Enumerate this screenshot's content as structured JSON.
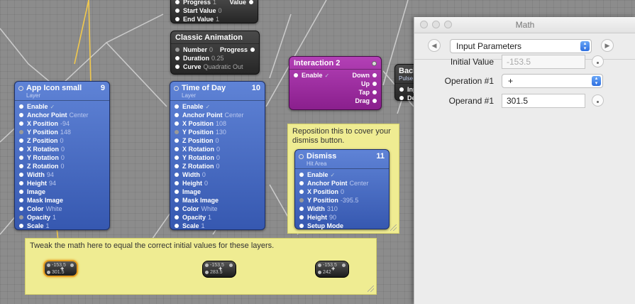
{
  "colors": {
    "note_bg": "#efec92",
    "blue_patch": "#3658b0",
    "purple_patch": "#8a1f8d",
    "dark_patch": "#262626",
    "selection": "#e8a020"
  },
  "top_patch": {
    "rows": [
      {
        "label": "Progress",
        "value": "1"
      },
      {
        "label": "Start Value",
        "value": "0"
      },
      {
        "label": "End Value",
        "value": "1"
      }
    ],
    "right_label": "Value"
  },
  "classic": {
    "title": "Classic Animation",
    "rows": [
      {
        "label": "Number",
        "value": "0"
      },
      {
        "label": "Duration",
        "value": "0.25"
      },
      {
        "label": "Curve",
        "value": "Quadratic Out"
      }
    ],
    "output_label": "Progress"
  },
  "interaction": {
    "title": "Interaction 2",
    "enable_label": "Enable",
    "outputs": [
      "Down",
      "Up",
      "Tap",
      "Drag"
    ]
  },
  "back": {
    "title": "Back",
    "subtitle": "Pulse",
    "rows": [
      "Inp",
      "De"
    ]
  },
  "app_icon": {
    "title": "App Icon small",
    "subtitle": "Layer",
    "number": "9",
    "rows": [
      {
        "label": "Enable",
        "value": "✓"
      },
      {
        "label": "Anchor Point",
        "value": "Center"
      },
      {
        "label": "X Position",
        "value": "-94"
      },
      {
        "label": "Y Position",
        "value": "148"
      },
      {
        "label": "Z Position",
        "value": "0"
      },
      {
        "label": "X Rotation",
        "value": "0"
      },
      {
        "label": "Y Rotation",
        "value": "0"
      },
      {
        "label": "Z Rotation",
        "value": "0"
      },
      {
        "label": "Width",
        "value": "94"
      },
      {
        "label": "Height",
        "value": "94"
      },
      {
        "label": "Image",
        "value": ""
      },
      {
        "label": "Mask Image",
        "value": ""
      },
      {
        "label": "Color",
        "value": "White"
      },
      {
        "label": "Opacity",
        "value": "1"
      },
      {
        "label": "Scale",
        "value": "1"
      }
    ]
  },
  "time_of_day": {
    "title": "Time of Day",
    "subtitle": "Layer",
    "number": "10",
    "rows": [
      {
        "label": "Enable",
        "value": "✓"
      },
      {
        "label": "Anchor Point",
        "value": "Center"
      },
      {
        "label": "X Position",
        "value": "108"
      },
      {
        "label": "Y Position",
        "value": "130"
      },
      {
        "label": "Z Position",
        "value": "0"
      },
      {
        "label": "X Rotation",
        "value": "0"
      },
      {
        "label": "Y Rotation",
        "value": "0"
      },
      {
        "label": "Z Rotation",
        "value": "0"
      },
      {
        "label": "Width",
        "value": "0"
      },
      {
        "label": "Height",
        "value": "0"
      },
      {
        "label": "Image",
        "value": ""
      },
      {
        "label": "Mask Image",
        "value": ""
      },
      {
        "label": "Color",
        "value": "White"
      },
      {
        "label": "Opacity",
        "value": "1"
      },
      {
        "label": "Scale",
        "value": "1"
      }
    ]
  },
  "dismiss": {
    "title": "Dismiss",
    "subtitle": "Hit Area",
    "number": "11",
    "rows": [
      {
        "label": "Enable",
        "value": "✓"
      },
      {
        "label": "Anchor Point",
        "value": "Center"
      },
      {
        "label": "X Position",
        "value": "0"
      },
      {
        "label": "Y Position",
        "value": "-395.5"
      },
      {
        "label": "Width",
        "value": "310"
      },
      {
        "label": "Height",
        "value": "90"
      },
      {
        "label": "Setup Mode",
        "value": ""
      }
    ]
  },
  "notes": {
    "reposition": "Reposition this to cover your dismiss button.",
    "tweak": "Tweak the math here to equal the correct initial values for these layers."
  },
  "math_nodes": [
    {
      "a": "-153.5",
      "op": "+",
      "b": "301.5"
    },
    {
      "a": "-153.5",
      "op": "+",
      "b": "283.5"
    },
    {
      "a": "-153.5",
      "op": "+",
      "b": "242"
    }
  ],
  "window": {
    "title": "Math",
    "section": "Input Parameters",
    "params": [
      {
        "label": "Initial Value",
        "value": "-153.5"
      },
      {
        "label": "Operation #1",
        "value": "+"
      },
      {
        "label": "Operand #1",
        "value": "301.5"
      }
    ]
  }
}
